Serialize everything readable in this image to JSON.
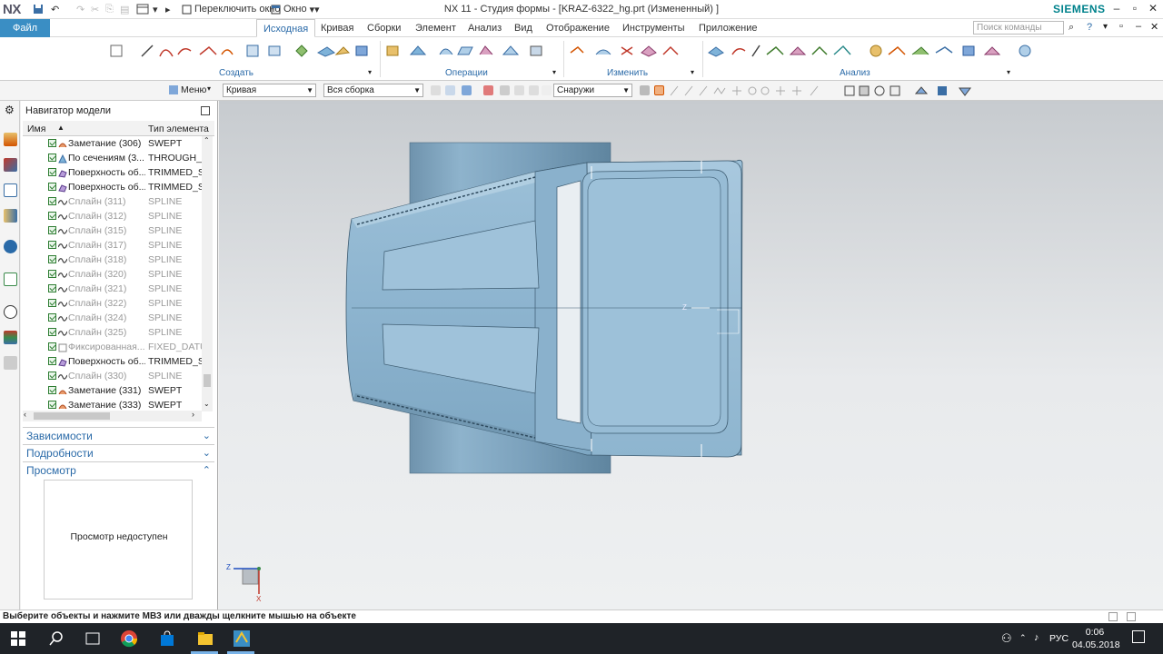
{
  "titlebar": {
    "logo": "NX",
    "switch_window": "Переключить окно",
    "window_menu": "Окно",
    "title": "NX 11 - Студия формы - [KRAZ-6322_hg.prt (Измененный) ]",
    "brand": "SIEMENS"
  },
  "ribbon": {
    "file_tab": "Файл",
    "tabs": [
      "Исходная",
      "Кривая",
      "Сборки",
      "Элемент",
      "Анализ",
      "Вид",
      "Отображение",
      "Инструменты",
      "Приложение"
    ],
    "active_tab": "Исходная",
    "command_search_placeholder": "Поиск команды",
    "groups": [
      "Создать",
      "Операции",
      "Изменить",
      "Анализ"
    ]
  },
  "selection_bar": {
    "menu_label": "Меню",
    "type_filter": "Кривая",
    "scope": "Вся сборка",
    "snap_mode": "Снаружи"
  },
  "navigator": {
    "title": "Навигатор модели",
    "columns": [
      "Имя",
      "Тип элемента"
    ],
    "rows": [
      {
        "name": "Заметание (306)",
        "type": "SWEPT",
        "icon": "swept-icon",
        "dim": false
      },
      {
        "name": "По сечениям (3...",
        "type": "THROUGH_C",
        "icon": "through-curves-icon",
        "dim": false
      },
      {
        "name": "Поверхность об...",
        "type": "TRIMMED_SH",
        "icon": "trimmed-surface-icon",
        "dim": false
      },
      {
        "name": "Поверхность об...",
        "type": "TRIMMED_SH",
        "icon": "trimmed-surface-icon",
        "dim": false
      },
      {
        "name": "Сплайн (311)",
        "type": "SPLINE",
        "icon": "spline-icon",
        "dim": true
      },
      {
        "name": "Сплайн (312)",
        "type": "SPLINE",
        "icon": "spline-icon",
        "dim": true
      },
      {
        "name": "Сплайн (315)",
        "type": "SPLINE",
        "icon": "spline-icon",
        "dim": true
      },
      {
        "name": "Сплайн (317)",
        "type": "SPLINE",
        "icon": "spline-icon",
        "dim": true
      },
      {
        "name": "Сплайн (318)",
        "type": "SPLINE",
        "icon": "spline-icon",
        "dim": true
      },
      {
        "name": "Сплайн (320)",
        "type": "SPLINE",
        "icon": "spline-icon",
        "dim": true
      },
      {
        "name": "Сплайн (321)",
        "type": "SPLINE",
        "icon": "spline-icon",
        "dim": true
      },
      {
        "name": "Сплайн (322)",
        "type": "SPLINE",
        "icon": "spline-icon",
        "dim": true
      },
      {
        "name": "Сплайн (324)",
        "type": "SPLINE",
        "icon": "spline-icon",
        "dim": true
      },
      {
        "name": "Сплайн (325)",
        "type": "SPLINE",
        "icon": "spline-icon",
        "dim": true
      },
      {
        "name": "Фиксированная...",
        "type": "FIXED_DATUM",
        "icon": "datum-plane-icon",
        "dim": true
      },
      {
        "name": "Поверхность об...",
        "type": "TRIMMED_SH",
        "icon": "trimmed-surface-icon",
        "dim": false
      },
      {
        "name": "Сплайн (330)",
        "type": "SPLINE",
        "icon": "spline-icon",
        "dim": true
      },
      {
        "name": "Заметание (331)",
        "type": "SWEPT",
        "icon": "swept-icon",
        "dim": false
      },
      {
        "name": "Заметание (333)",
        "type": "SWEPT",
        "icon": "swept-icon",
        "dim": false
      }
    ],
    "panels": {
      "dependencies": "Зависимости",
      "details": "Подробности",
      "preview": "Просмотр",
      "preview_unavailable": "Просмотр недоступен"
    }
  },
  "viewport": {
    "triad_z": "Z",
    "triad_x": "X",
    "wcs_label": "Z"
  },
  "status_bar": {
    "message": "Выберите объекты и нажмите МВ3 или дважды щелкните мышью на объекте"
  },
  "taskbar": {
    "language": "РУС",
    "time": "0:06",
    "date": "04.05.2018"
  }
}
